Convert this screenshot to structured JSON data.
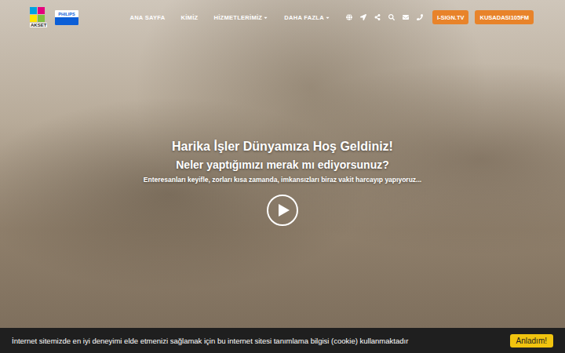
{
  "logos": [
    {
      "text": "AKSET"
    },
    {
      "text": "PHILIPS"
    }
  ],
  "nav": {
    "items": [
      {
        "label": "ANA SAYFA",
        "dropdown": false
      },
      {
        "label": "KİMİZ",
        "dropdown": false
      },
      {
        "label": "HİZMETLERİMİZ",
        "dropdown": true
      },
      {
        "label": "DAHA FAZLA",
        "dropdown": true
      }
    ],
    "buttons": [
      "I-SIGN.TV",
      "KUSADASI105FM"
    ]
  },
  "hero": {
    "title": "Harika İşler Dünyamıza Hoş Geldiniz!",
    "subtitle": "Neler yaptığımızı merak mı ediyorsunuz?",
    "tagline": "Enteresanları keyifle, zorları kısa zamanda, imkansızları biraz vakit harcayıp yapıyoruz..."
  },
  "cookie_bar": {
    "text": "İnternet sitemizde en iyi deneyimi elde etmenizi sağlamak için bu internet sitesi tanımlama bilgisi (cookie) kullanmaktadır",
    "button": "Anladım!"
  }
}
